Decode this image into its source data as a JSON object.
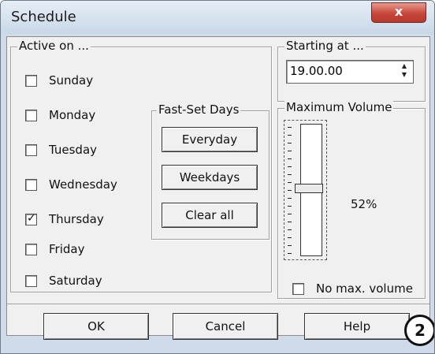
{
  "window": {
    "title": "Schedule",
    "close_glyph": "x"
  },
  "active_on": {
    "label": "Active on ...",
    "days": [
      {
        "label": "Sunday",
        "checked": false
      },
      {
        "label": "Monday",
        "checked": false
      },
      {
        "label": "Tuesday",
        "checked": false
      },
      {
        "label": "Wednesday",
        "checked": false
      },
      {
        "label": "Thursday",
        "checked": true
      },
      {
        "label": "Friday",
        "checked": false
      },
      {
        "label": "Saturday",
        "checked": false
      }
    ]
  },
  "fast_set": {
    "label": "Fast-Set Days",
    "everyday": "Everyday",
    "weekdays": "Weekdays",
    "clear_all": "Clear all"
  },
  "starting_at": {
    "label": "Starting at ...",
    "value": "19.00.00"
  },
  "max_volume": {
    "label": "Maximum Volume",
    "percent_text": "52%",
    "level": 0.52,
    "no_max_label": "No max. volume",
    "no_max_checked": false
  },
  "footer": {
    "ok": "OK",
    "cancel": "Cancel",
    "help": "Help"
  },
  "badge": "2",
  "check_glyph": "✓"
}
